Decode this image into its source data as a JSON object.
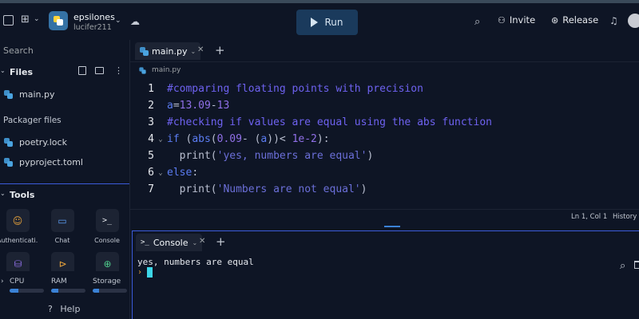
{
  "topbar": {
    "repl_name": "epsilones",
    "username": "lucifer211",
    "run_label": "Run",
    "invite_label": "Invite",
    "release_label": "Release"
  },
  "sidebar": {
    "search_label": "Search",
    "files_header": "Files",
    "files": [
      "main.py"
    ],
    "packager_label": "Packager files",
    "packager_files": [
      "poetry.lock",
      "pyproject.toml"
    ],
    "tools_header": "Tools",
    "tools": [
      {
        "label": "Authenticati...",
        "icon": "person-icon"
      },
      {
        "label": "Chat",
        "icon": "chat-icon"
      },
      {
        "label": "Console",
        "icon": "terminal-icon"
      }
    ],
    "resources": [
      {
        "label": "CPU",
        "level": 0.25
      },
      {
        "label": "RAM",
        "level": 0.2
      },
      {
        "label": "Storage",
        "level": 0.18
      }
    ],
    "help_label": "Help"
  },
  "editor": {
    "tab_label": "main.py",
    "breadcrumb": "main.py",
    "lines": [
      {
        "n": "1",
        "fold": ""
      },
      {
        "n": "2",
        "fold": ""
      },
      {
        "n": "3",
        "fold": ""
      },
      {
        "n": "4",
        "fold": "⌄"
      },
      {
        "n": "5",
        "fold": ""
      },
      {
        "n": "6",
        "fold": "⌄"
      },
      {
        "n": "7",
        "fold": ""
      }
    ],
    "cursor_pos": "Ln 1, Col 1",
    "history_label": "History"
  },
  "console": {
    "tab_label": "Console",
    "output": "yes, numbers are equal"
  },
  "colors": {
    "background": "#0e1525",
    "run_button": "#1a3a5c",
    "accent": "#3b82d6",
    "comment": "#6e62f0"
  }
}
